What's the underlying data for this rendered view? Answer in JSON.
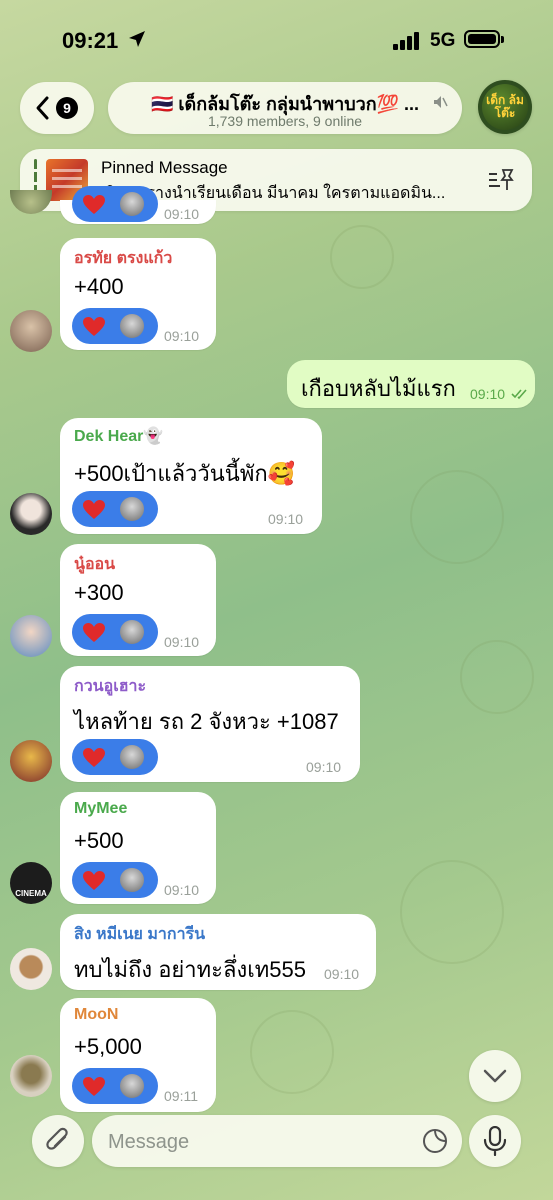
{
  "status_bar": {
    "time": "09:21",
    "network": "5G"
  },
  "header": {
    "back_badge": "9",
    "title": "🇹🇭 เด็กล้มโต๊ะ กลุ่มนำพาบวก💯 ...",
    "subtitle": "1,739 members, 9 online",
    "avatar_text": "เด็ก ล้มโต๊ะ"
  },
  "pinned": {
    "label": "Pinned Message",
    "text": "เปิดตารางนำเรียนเดือน มีนาคม ใครตามแอดมิน..."
  },
  "messages": [
    {
      "sender": "",
      "text": "",
      "time": "09:10",
      "sender_color": "#000000"
    },
    {
      "sender": "อรทัย ตรงแก้ว",
      "text": "+400",
      "time": "09:10",
      "sender_color": "#d94a47"
    },
    {
      "sender": "",
      "text": "เกือบหลับไม้แรก",
      "time": "09:10",
      "sender_color": "#000000"
    },
    {
      "sender": "Dek Hear👻",
      "text": "+500เป้าแล้ววันนี้พัก🥰",
      "time": "09:10",
      "sender_color": "#4aa94c"
    },
    {
      "sender": "นู๋ออน",
      "text": "+300",
      "time": "09:10",
      "sender_color": "#d94a47"
    },
    {
      "sender": "กวนอูเฮาะ",
      "text": "ไหลท้าย รถ 2 จังหวะ +1087",
      "time": "09:10",
      "sender_color": "#8e5cc9"
    },
    {
      "sender": "MyMee",
      "text": "+500",
      "time": "09:10",
      "sender_color": "#4aa94c"
    },
    {
      "sender": "สิง หมีเนย มาการีน",
      "text": "ทบไม่ถึง อย่าทะลึ่งเท555",
      "time": "09:10",
      "sender_color": "#3b78c9"
    },
    {
      "sender": "MooN",
      "text": "+5,000",
      "time": "09:11",
      "sender_color": "#e0873a"
    }
  ],
  "avatars": {
    "cinema_label": "CINEMA"
  },
  "input": {
    "placeholder": "Message",
    "value": ""
  },
  "colors": {
    "reaction_bg": "#3b7de8",
    "outgoing_bubble": "#e1fcc4",
    "incoming_bubble": "#ffffff"
  },
  "icons": [
    "location-arrow-icon",
    "signal-icon",
    "battery-icon",
    "back-chevron-icon",
    "mute-icon",
    "pin-list-icon",
    "heart-icon",
    "chevron-down-icon",
    "paperclip-icon",
    "sticker-icon",
    "microphone-icon",
    "double-check-icon"
  ]
}
